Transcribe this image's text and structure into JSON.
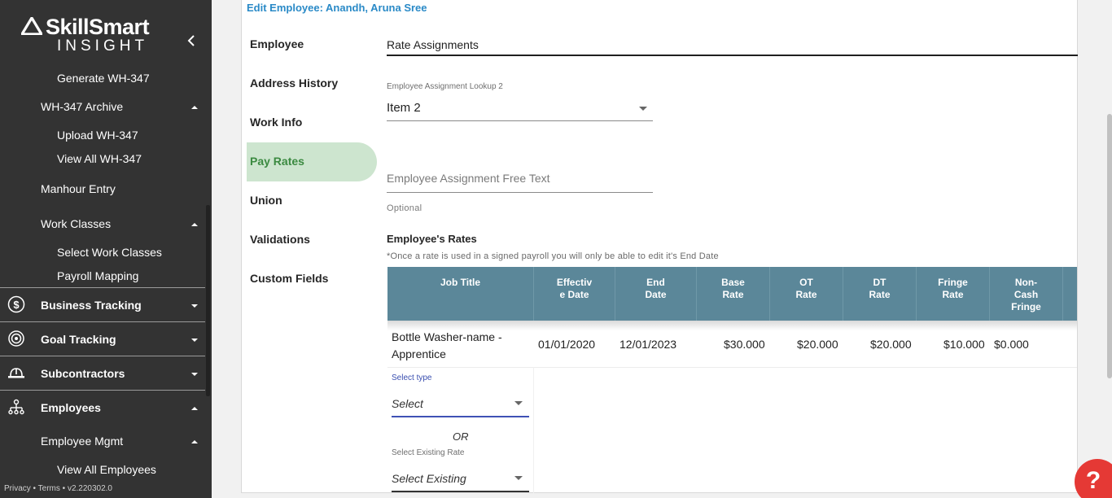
{
  "brand": {
    "name": "SkillSmart",
    "sub": "INSIGHT"
  },
  "sidebar": {
    "items": [
      {
        "label": "Generate WH-347"
      },
      {
        "label": "WH-347 Archive"
      },
      {
        "label": "Upload WH-347"
      },
      {
        "label": "View All WH-347"
      },
      {
        "label": "Manhour Entry"
      },
      {
        "label": "Work Classes"
      },
      {
        "label": "Select Work Classes"
      },
      {
        "label": "Payroll Mapping"
      },
      {
        "label": "Business Tracking"
      },
      {
        "label": "Goal Tracking"
      },
      {
        "label": "Subcontractors"
      },
      {
        "label": "Employees"
      },
      {
        "label": "Employee Mgmt"
      },
      {
        "label": "View All Employees"
      }
    ],
    "footer": "Privacy • Terms • v2.220302.0"
  },
  "page": {
    "edit_title": "Edit Employee: Anandh, Aruna Sree",
    "nav": [
      {
        "label": "Employee"
      },
      {
        "label": "Address History"
      },
      {
        "label": "Work Info"
      },
      {
        "label": "Pay Rates"
      },
      {
        "label": "Union"
      },
      {
        "label": "Validations"
      },
      {
        "label": "Custom Fields"
      }
    ],
    "section_title": "Rate Assignments",
    "lookup_label": "Employee Assignment Lookup 2",
    "lookup_value": "Item 2",
    "free_text_placeholder": "Employee Assignment Free Text",
    "optional": "Optional",
    "rates_title": "Employee's Rates",
    "rates_note": "*Once a rate is used in a signed payroll you will only be able to edit it's End Date"
  },
  "table": {
    "headers": [
      {
        "label": "Job Title"
      },
      {
        "label": "Effectiv\ne Date"
      },
      {
        "label": "End\nDate"
      },
      {
        "label": "Base\nRate"
      },
      {
        "label": "OT\nRate"
      },
      {
        "label": "DT\nRate"
      },
      {
        "label": "Fringe\nRate"
      },
      {
        "label": "Non-\nCash\nFringe"
      }
    ],
    "row": {
      "job_title": "Bottle Washer-name - Apprentice",
      "effective_date": "01/01/2020",
      "end_date": "12/01/2023",
      "base_rate": "$30.000",
      "ot_rate": "$20.000",
      "dt_rate": "$20.000",
      "fringe_rate": "$10.000",
      "non_cash_fringe": "$0.000"
    },
    "new_rate": {
      "select_type_label": "Select type",
      "select_type_value": "Select",
      "or": "OR",
      "existing_label": "Select Existing Rate",
      "existing_value": "Select Existing"
    }
  },
  "help": "?"
}
